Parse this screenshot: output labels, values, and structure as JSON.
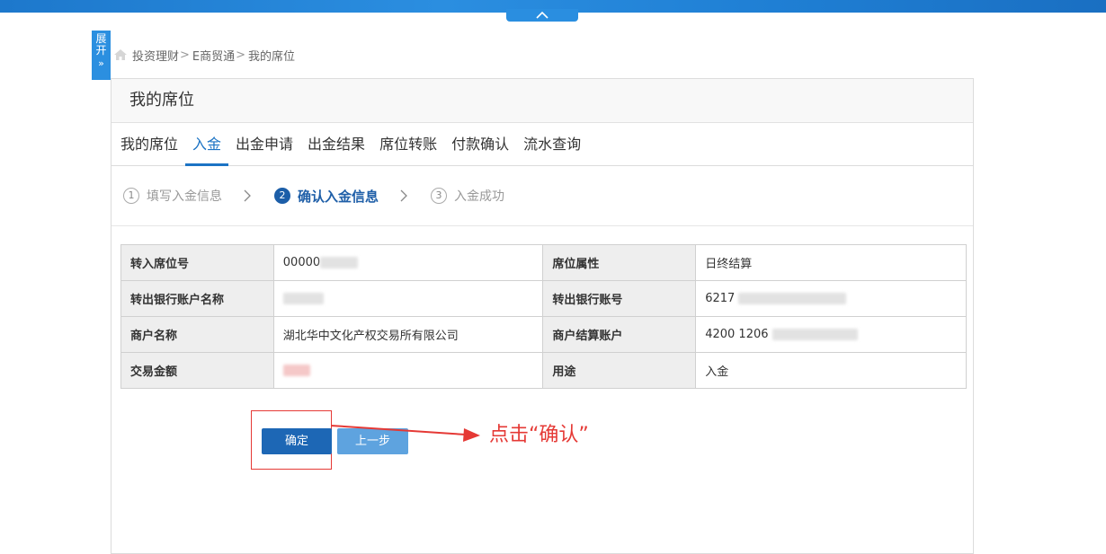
{
  "sidebar_toggle": {
    "label_line1": "展",
    "label_line2": "开",
    "chevron": "»"
  },
  "breadcrumb": {
    "items": [
      "投资理财",
      "E商贸通",
      "我的席位"
    ],
    "separator": ">"
  },
  "panel": {
    "title": "我的席位"
  },
  "tabs": [
    {
      "label": "我的席位",
      "active": false
    },
    {
      "label": "入金",
      "active": true
    },
    {
      "label": "出金申请",
      "active": false
    },
    {
      "label": "出金结果",
      "active": false
    },
    {
      "label": "席位转账",
      "active": false
    },
    {
      "label": "付款确认",
      "active": false
    },
    {
      "label": "流水查询",
      "active": false
    }
  ],
  "steps": [
    {
      "number": "1",
      "label": "填写入金信息",
      "current": false
    },
    {
      "number": "2",
      "label": "确认入金信息",
      "current": true
    },
    {
      "number": "3",
      "label": "入金成功",
      "current": false
    }
  ],
  "info_table": {
    "rows": [
      {
        "key1": "转入席位号",
        "val1": "00000",
        "key2": "席位属性",
        "val2": "日终结算"
      },
      {
        "key1": "转出银行账户名称",
        "val1": "",
        "key2": "转出银行账号",
        "val2": "6217"
      },
      {
        "key1": "商户名称",
        "val1": "湖北华中文化产权交易所有限公司",
        "key2": "商户结算账户",
        "val2": "4200 1206"
      },
      {
        "key1": "交易金额",
        "val1": "",
        "key2": "用途",
        "val2": "入金"
      }
    ]
  },
  "buttons": {
    "confirm": "确定",
    "previous": "上一步"
  },
  "annotation": {
    "text": "点击“确认”",
    "color": "#e53935"
  },
  "colors": {
    "accent": "#1c73c4",
    "topbar": "#2b8ee0",
    "confirm_button": "#1d67b5",
    "prev_button": "#5ea3df"
  },
  "icons": {
    "home": "home-icon",
    "collapse": "chevron-up-icon",
    "step_arrow": "chevron-right-icon"
  }
}
